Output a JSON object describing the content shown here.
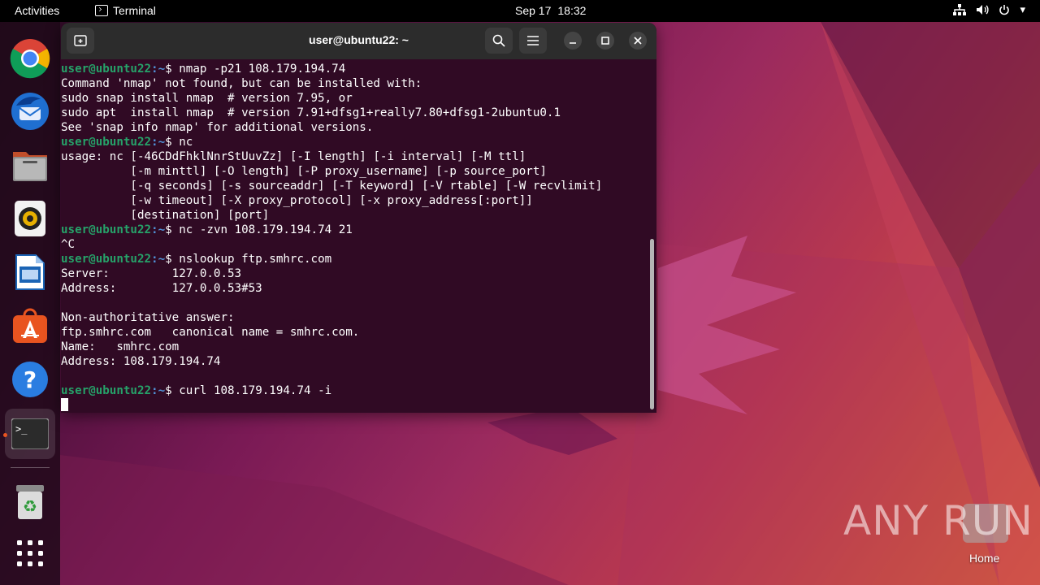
{
  "topbar": {
    "activities": "Activities",
    "app_name": "Terminal",
    "date": "Sep 17",
    "time": "18:32",
    "tray_icons": [
      "network-icon",
      "volume-icon",
      "power-icon"
    ]
  },
  "dock": {
    "items": [
      "chrome",
      "thunderbird",
      "files",
      "rhythmbox",
      "libreoffice-writer",
      "app-center",
      "help",
      "terminal",
      "trash",
      "show-apps"
    ]
  },
  "terminal": {
    "title": "user@ubuntu22: ~",
    "prompt_user": "user@ubuntu22",
    "prompt_path": ":~",
    "prompt_symbol": "$ ",
    "lines": [
      {
        "type": "prompt",
        "cmd": "nmap -p21 108.179.194.74"
      },
      {
        "type": "out",
        "text": "Command 'nmap' not found, but can be installed with:"
      },
      {
        "type": "out",
        "text": "sudo snap install nmap  # version 7.95, or"
      },
      {
        "type": "out",
        "text": "sudo apt  install nmap  # version 7.91+dfsg1+really7.80+dfsg1-2ubuntu0.1"
      },
      {
        "type": "out",
        "text": "See 'snap info nmap' for additional versions."
      },
      {
        "type": "prompt",
        "cmd": "nc"
      },
      {
        "type": "out",
        "text": "usage: nc [-46CDdFhklNnrStUuvZz] [-I length] [-i interval] [-M ttl]"
      },
      {
        "type": "out",
        "text": "          [-m minttl] [-O length] [-P proxy_username] [-p source_port]"
      },
      {
        "type": "out",
        "text": "          [-q seconds] [-s sourceaddr] [-T keyword] [-V rtable] [-W recvlimit]"
      },
      {
        "type": "out",
        "text": "          [-w timeout] [-X proxy_protocol] [-x proxy_address[:port]]"
      },
      {
        "type": "out",
        "text": "          [destination] [port]"
      },
      {
        "type": "prompt",
        "cmd": "nc -zvn 108.179.194.74 21"
      },
      {
        "type": "out",
        "text": "^C"
      },
      {
        "type": "prompt",
        "cmd": "nslookup ftp.smhrc.com"
      },
      {
        "type": "out",
        "text": "Server:         127.0.0.53"
      },
      {
        "type": "out",
        "text": "Address:        127.0.0.53#53"
      },
      {
        "type": "out",
        "text": ""
      },
      {
        "type": "out",
        "text": "Non-authoritative answer:"
      },
      {
        "type": "out",
        "text": "ftp.smhrc.com   canonical name = smhrc.com."
      },
      {
        "type": "out",
        "text": "Name:   smhrc.com"
      },
      {
        "type": "out",
        "text": "Address: 108.179.194.74"
      },
      {
        "type": "out",
        "text": ""
      },
      {
        "type": "prompt",
        "cmd": "curl 108.179.194.74 -i"
      },
      {
        "type": "cursor",
        "text": ""
      }
    ]
  },
  "desktop": {
    "watermark": "ANY RUN",
    "home_label": "Home"
  }
}
